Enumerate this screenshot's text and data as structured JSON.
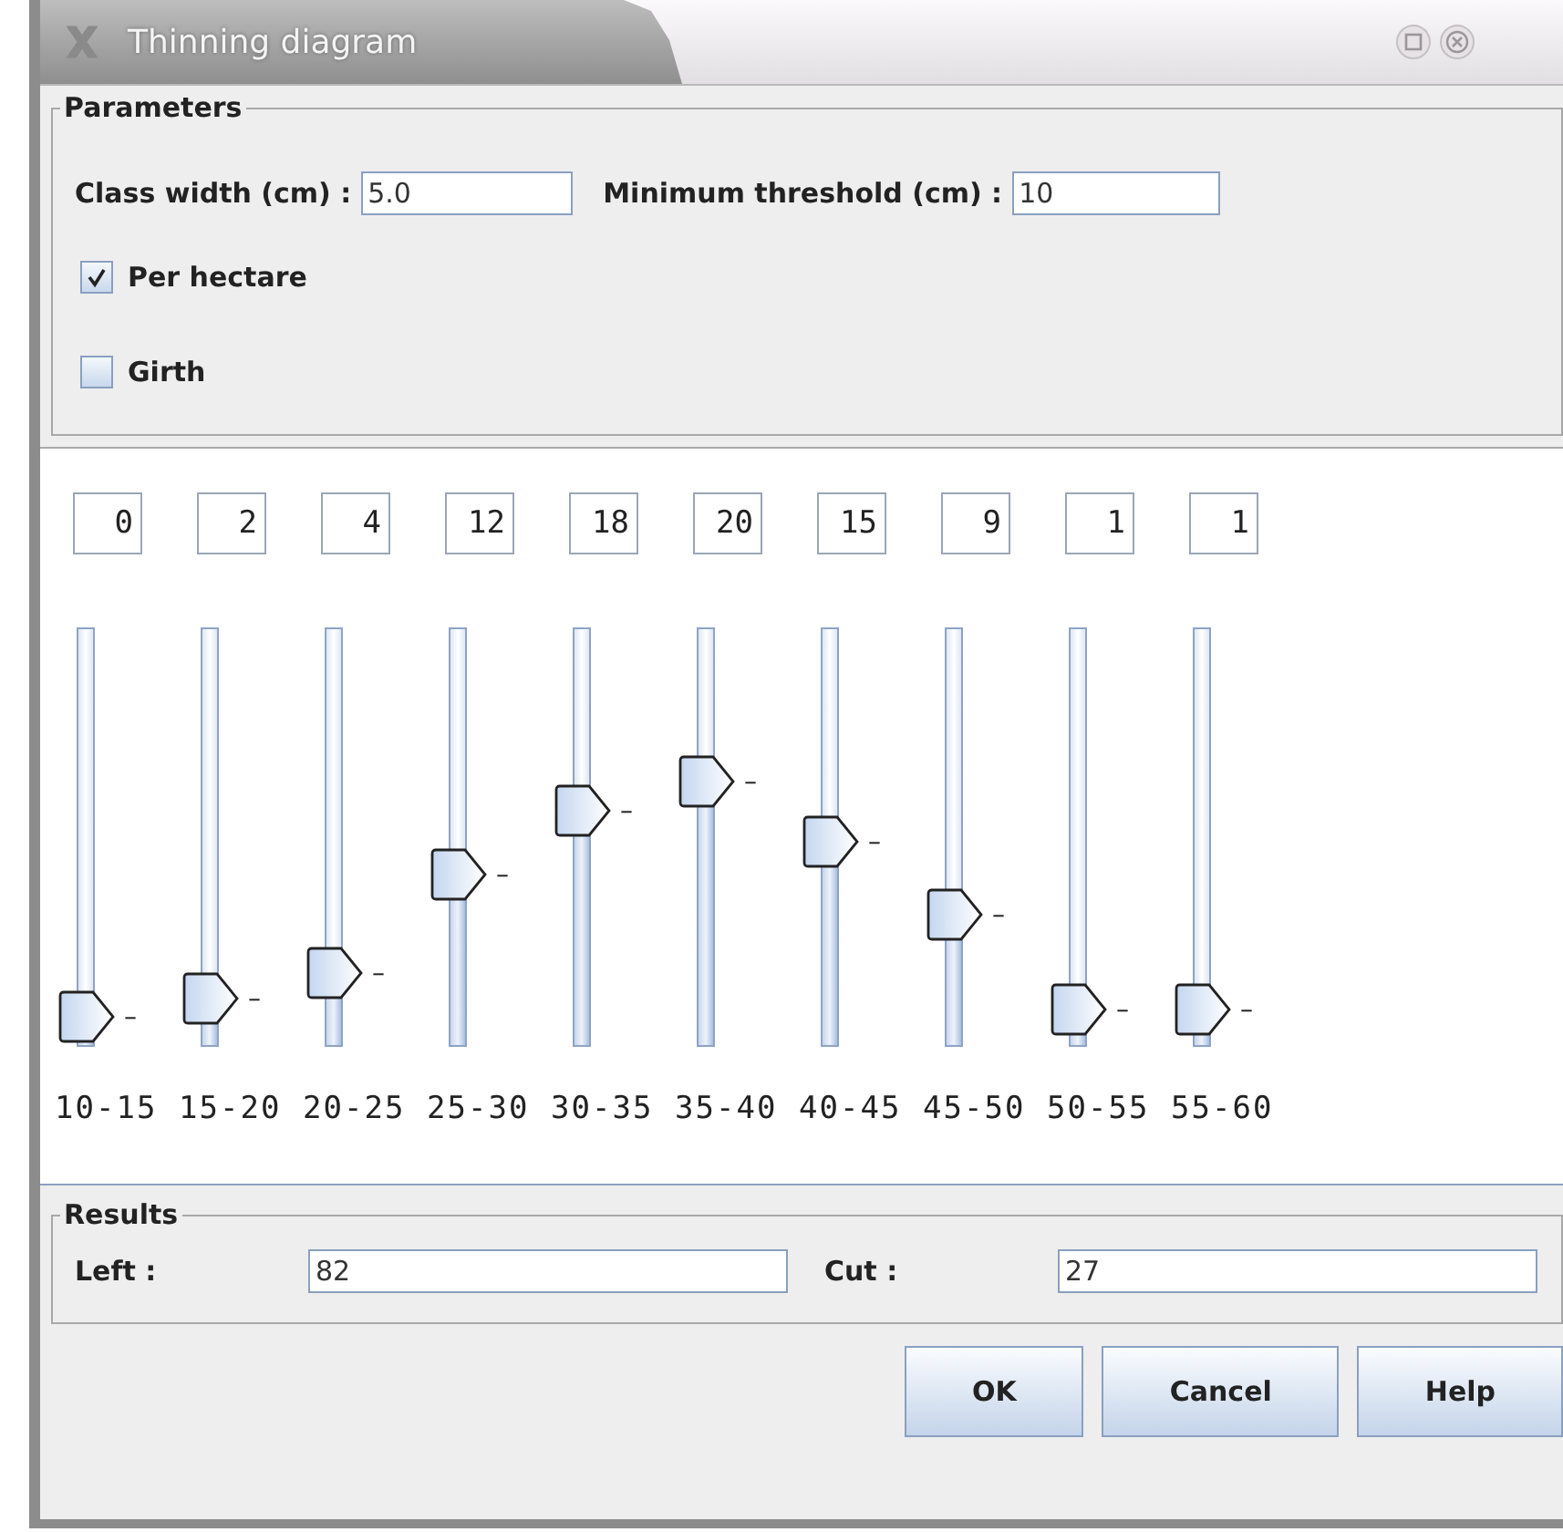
{
  "window": {
    "title": "Thinning diagram"
  },
  "parameters": {
    "legend": "Parameters",
    "class_width": {
      "label": "Class width (cm) :",
      "value": "5.0"
    },
    "minimum_threshold": {
      "label": "Minimum threshold (cm) :",
      "value": "10"
    },
    "checkboxes": [
      {
        "label": "Per hectare",
        "checked": true
      },
      {
        "label": "Girth",
        "checked": false
      }
    ]
  },
  "sliders": [
    {
      "value": "0",
      "level": 0,
      "tick": "–",
      "label": "10-15"
    },
    {
      "value": "2",
      "level": 0.05,
      "tick": "–",
      "label": "15-20"
    },
    {
      "value": "4",
      "level": 0.12,
      "tick": "–",
      "label": "20-25"
    },
    {
      "value": "12",
      "level": 0.39,
      "tick": "–",
      "label": "25-30"
    },
    {
      "value": "18",
      "level": 0.57,
      "tick": "–",
      "label": "30-35"
    },
    {
      "value": "20",
      "level": 0.65,
      "tick": "–",
      "label": "35-40"
    },
    {
      "value": "15",
      "level": 0.48,
      "tick": "–",
      "label": "40-45"
    },
    {
      "value": "9",
      "level": 0.28,
      "tick": "–",
      "label": "45-50"
    },
    {
      "value": "1",
      "level": 0.02,
      "tick": "–",
      "label": "50-55"
    },
    {
      "value": "1",
      "level": 0.02,
      "tick": "–",
      "label": "55-60"
    }
  ],
  "results": {
    "legend": "Results",
    "left": {
      "label": "Left :",
      "value": "82"
    },
    "cut": {
      "label": "Cut :",
      "value": "27"
    }
  },
  "buttons": [
    "OK",
    "Cancel",
    "Help"
  ]
}
